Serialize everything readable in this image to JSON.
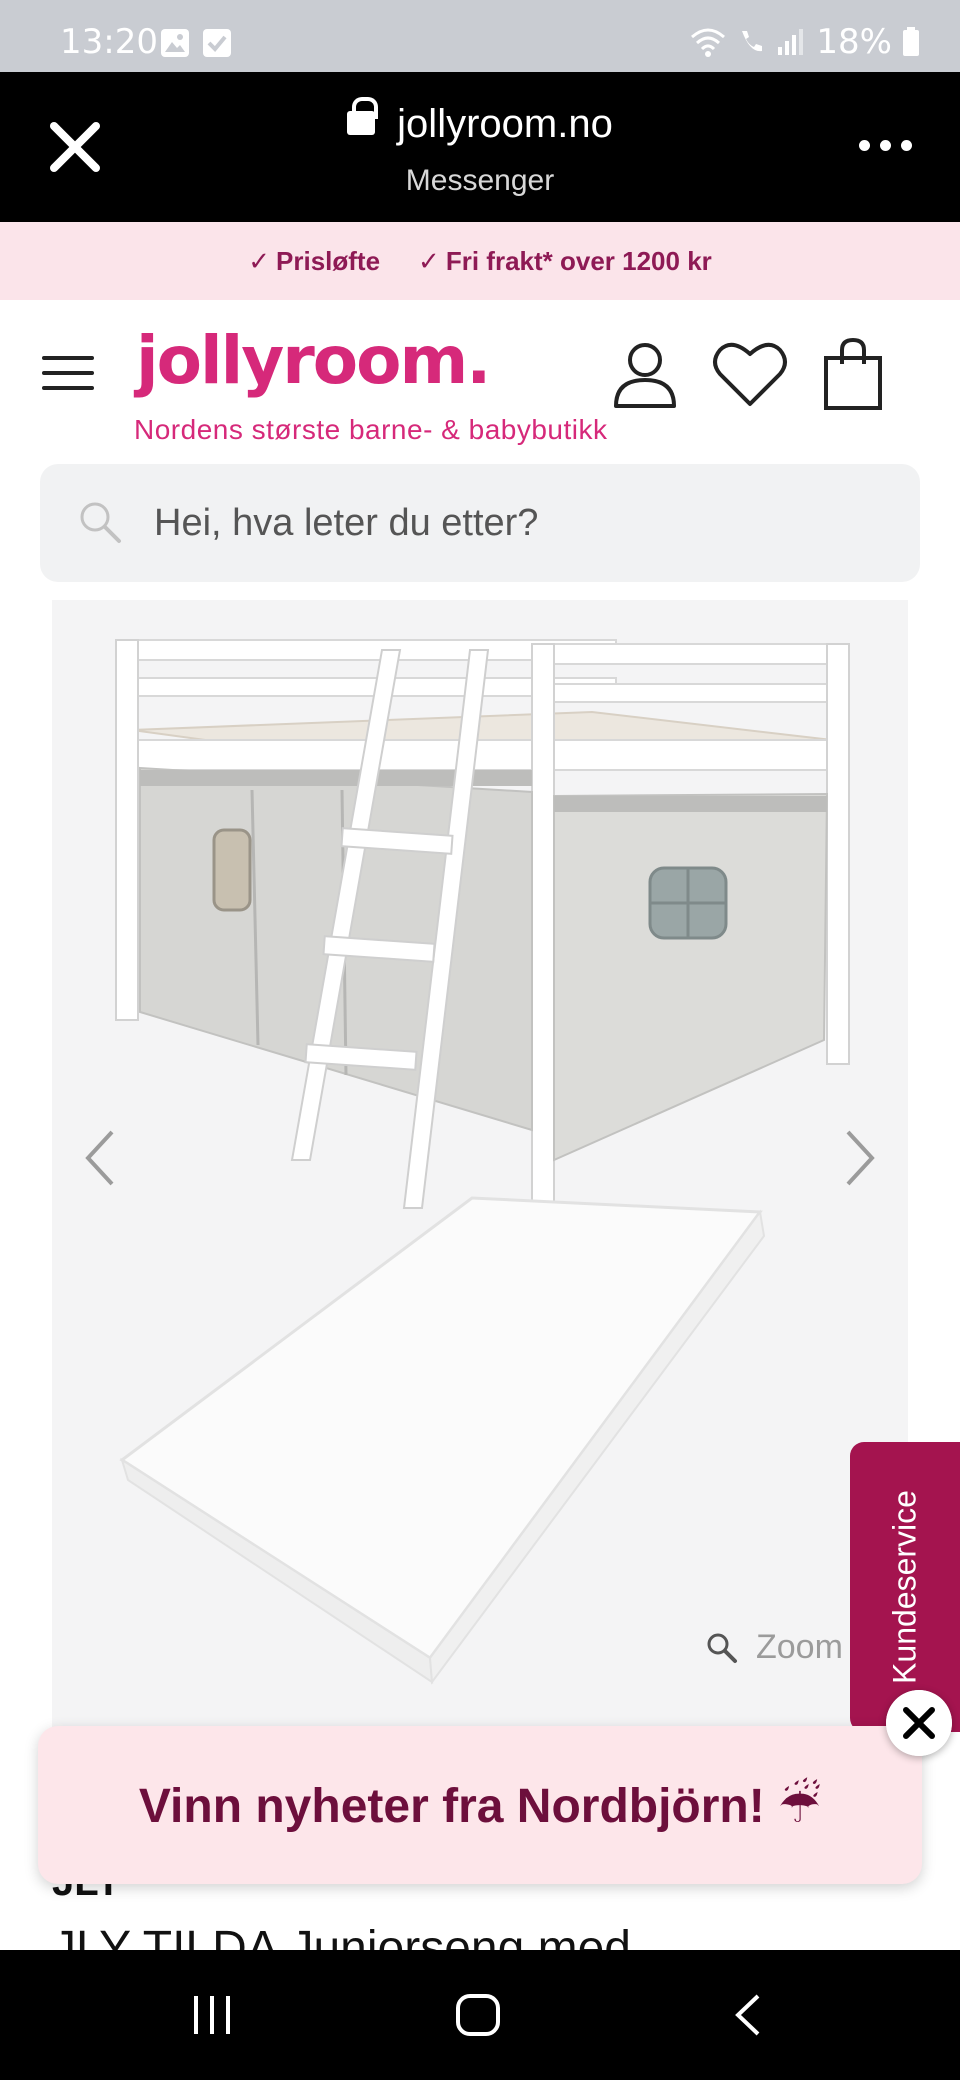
{
  "status_bar": {
    "time": "13:20",
    "battery": "18%",
    "icons": [
      "image-notification-icon",
      "check-notification-icon",
      "wifi-icon",
      "wifi-calling-icon",
      "signal-icon",
      "battery-icon"
    ]
  },
  "browser": {
    "host": "jollyroom.no",
    "subtitle": "Messenger",
    "icons": [
      "close-icon",
      "lock-icon",
      "more-icon"
    ]
  },
  "promo": {
    "items": [
      "Prisløfte",
      "Fri frakt* over 1200 kr"
    ],
    "check_mark": "✓"
  },
  "header": {
    "logo": "jollyroom.",
    "tagline": "Nordens største barne- & babybutikk",
    "icons": [
      "menu-icon",
      "account-icon",
      "wishlist-heart-icon",
      "shopping-bag-icon"
    ]
  },
  "search": {
    "placeholder": "Hei, hva leter du etter?"
  },
  "gallery": {
    "zoom_label": "Zoom"
  },
  "kundeservice": {
    "label": "Kundeservice"
  },
  "product": {
    "brand": "JLY",
    "title": "JLY TILDA Juniorseng med"
  },
  "popup": {
    "text": "Vinn nyheter fra Nordbjörn! ☔"
  },
  "colors": {
    "brand_pink": "#d6297a",
    "promo_text": "#8e1a55",
    "kundeservice_bg": "#a4144f",
    "popup_bg": "#fde6ea",
    "popup_text": "#6d0f3c"
  }
}
